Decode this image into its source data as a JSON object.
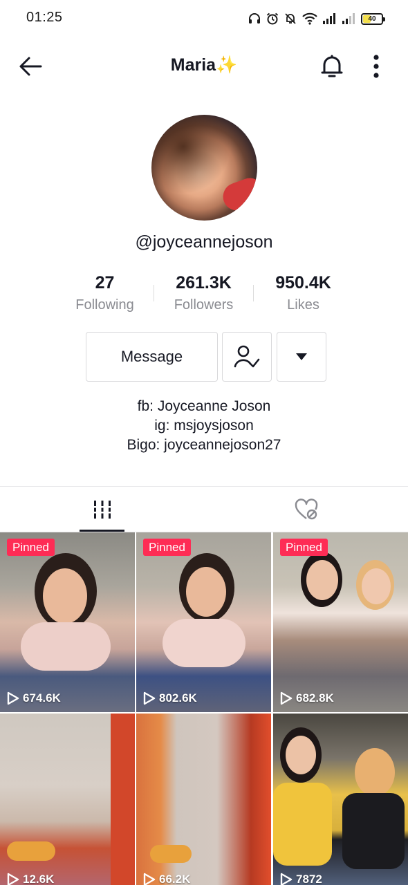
{
  "status_bar": {
    "time": "01:25",
    "battery": "40"
  },
  "header": {
    "title": "Maria✨"
  },
  "profile": {
    "handle": "@joyceannejoson",
    "stats": [
      {
        "value": "27",
        "label": "Following"
      },
      {
        "value": "261.3K",
        "label": "Followers"
      },
      {
        "value": "950.4K",
        "label": "Likes"
      }
    ],
    "message_label": "Message",
    "bio": [
      "fb: Joyceanne Joson",
      "ig: msjoysjoson",
      "Bigo: joyceannejoson27"
    ]
  },
  "tabs": {
    "active": "videos"
  },
  "videos": [
    {
      "pinned_label": "Pinned",
      "views": "674.6K"
    },
    {
      "pinned_label": "Pinned",
      "views": "802.6K"
    },
    {
      "pinned_label": "Pinned",
      "views": "682.8K"
    },
    {
      "views": "12.6K"
    },
    {
      "views": "66.2K"
    },
    {
      "views": "7872"
    }
  ],
  "colors": {
    "pinned_badge": "#fe2c55",
    "text_primary": "#161823",
    "text_secondary": "#8a8b91"
  },
  "icons": {
    "back": "arrow-left-icon",
    "bell": "bell-icon",
    "more": "more-vertical-icon",
    "follow": "user-check-icon",
    "dropdown": "caret-down-icon",
    "videos_tab": "grid-lines-icon",
    "liked_tab": "heart-hidden-icon",
    "play": "play-outline-icon"
  }
}
